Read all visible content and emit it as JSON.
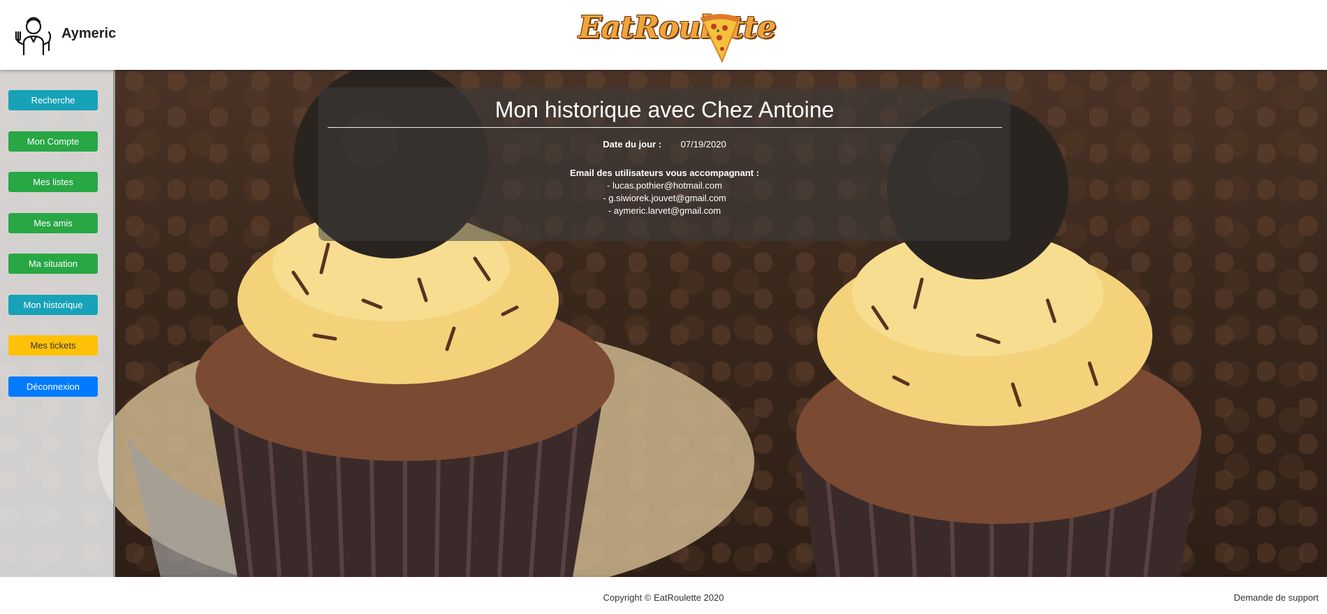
{
  "header": {
    "username": "Aymeric",
    "logo_text": "EatRoulette"
  },
  "sidebar": {
    "items": [
      {
        "label": "Recherche",
        "color": "#17a2b8"
      },
      {
        "label": "Mon Compte",
        "color": "#28a745"
      },
      {
        "label": "Mes listes",
        "color": "#28a745"
      },
      {
        "label": "Mes amis",
        "color": "#28a745"
      },
      {
        "label": "Ma situation",
        "color": "#28a745"
      },
      {
        "label": "Mon historique",
        "color": "#17a2b8"
      },
      {
        "label": "Mes tickets",
        "color": "#ffc107"
      },
      {
        "label": "Déconnexion",
        "color": "#007bff"
      }
    ]
  },
  "history": {
    "title": "Mon historique avec Chez Antoine",
    "date_label": "Date du jour :",
    "date_value": "07/19/2020",
    "emails_title": "Email des utilisateurs vous accompagnant :",
    "emails": [
      "- lucas.pothier@hotmail.com",
      "- g.siwiorek.jouvet@gmail.com",
      "- aymeric.larvet@gmail.com"
    ]
  },
  "footer": {
    "copyright": "Copyright © EatRoulette 2020",
    "support": "Demande de support"
  }
}
